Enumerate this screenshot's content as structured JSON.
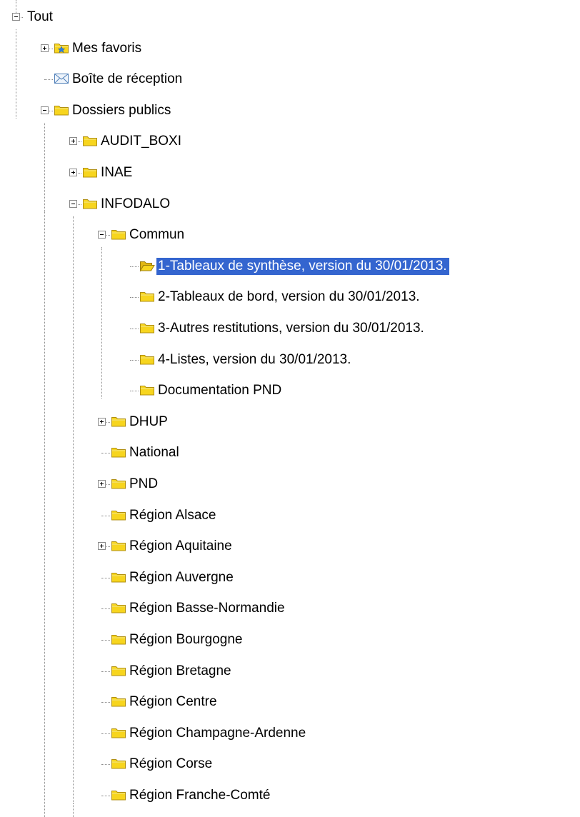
{
  "tree": {
    "selected_colors": {
      "background": "#3465cf",
      "text": "#ffffff"
    },
    "folder_color": "#f7d51e",
    "nodes": [
      {
        "label": "Tout",
        "level": 0,
        "expander": "minus",
        "icon": "none"
      },
      {
        "label": "Mes favoris",
        "level": 1,
        "expander": "plus",
        "icon": "favorites-folder-icon"
      },
      {
        "label": "Boîte de réception",
        "level": 1,
        "expander": "none",
        "icon": "inbox-envelope-icon"
      },
      {
        "label": "Dossiers publics",
        "level": 1,
        "expander": "minus",
        "icon": "folder-icon"
      },
      {
        "label": "AUDIT_BOXI",
        "level": 2,
        "expander": "plus",
        "icon": "folder-icon"
      },
      {
        "label": "INAE",
        "level": 2,
        "expander": "plus",
        "icon": "folder-icon"
      },
      {
        "label": "INFODALO",
        "level": 2,
        "expander": "minus",
        "icon": "folder-icon"
      },
      {
        "label": "Commun",
        "level": 3,
        "expander": "minus",
        "icon": "folder-icon"
      },
      {
        "label": "1-Tableaux de synthèse, version du 30/01/2013.",
        "level": 4,
        "expander": "none",
        "icon": "open-folder-icon",
        "selected": true
      },
      {
        "label": "2-Tableaux de bord, version du 30/01/2013.",
        "level": 4,
        "expander": "none",
        "icon": "folder-icon"
      },
      {
        "label": "3-Autres restitutions, version du 30/01/2013.",
        "level": 4,
        "expander": "none",
        "icon": "folder-icon"
      },
      {
        "label": "4-Listes, version du 30/01/2013.",
        "level": 4,
        "expander": "none",
        "icon": "folder-icon"
      },
      {
        "label": "Documentation PND",
        "level": 4,
        "expander": "none",
        "icon": "folder-icon"
      },
      {
        "label": "DHUP",
        "level": 3,
        "expander": "plus",
        "icon": "folder-icon"
      },
      {
        "label": "National",
        "level": 3,
        "expander": "none",
        "icon": "folder-icon"
      },
      {
        "label": "PND",
        "level": 3,
        "expander": "plus",
        "icon": "folder-icon"
      },
      {
        "label": "Région Alsace",
        "level": 3,
        "expander": "none",
        "icon": "folder-icon"
      },
      {
        "label": "Région Aquitaine",
        "level": 3,
        "expander": "plus",
        "icon": "folder-icon"
      },
      {
        "label": "Région Auvergne",
        "level": 3,
        "expander": "none",
        "icon": "folder-icon"
      },
      {
        "label": "Région Basse-Normandie",
        "level": 3,
        "expander": "none",
        "icon": "folder-icon"
      },
      {
        "label": "Région Bourgogne",
        "level": 3,
        "expander": "none",
        "icon": "folder-icon"
      },
      {
        "label": "Région Bretagne",
        "level": 3,
        "expander": "none",
        "icon": "folder-icon"
      },
      {
        "label": "Région Centre",
        "level": 3,
        "expander": "none",
        "icon": "folder-icon"
      },
      {
        "label": "Région Champagne-Ardenne",
        "level": 3,
        "expander": "none",
        "icon": "folder-icon"
      },
      {
        "label": "Région Corse",
        "level": 3,
        "expander": "none",
        "icon": "folder-icon"
      },
      {
        "label": "Région Franche-Comté",
        "level": 3,
        "expander": "none",
        "icon": "folder-icon"
      }
    ]
  }
}
